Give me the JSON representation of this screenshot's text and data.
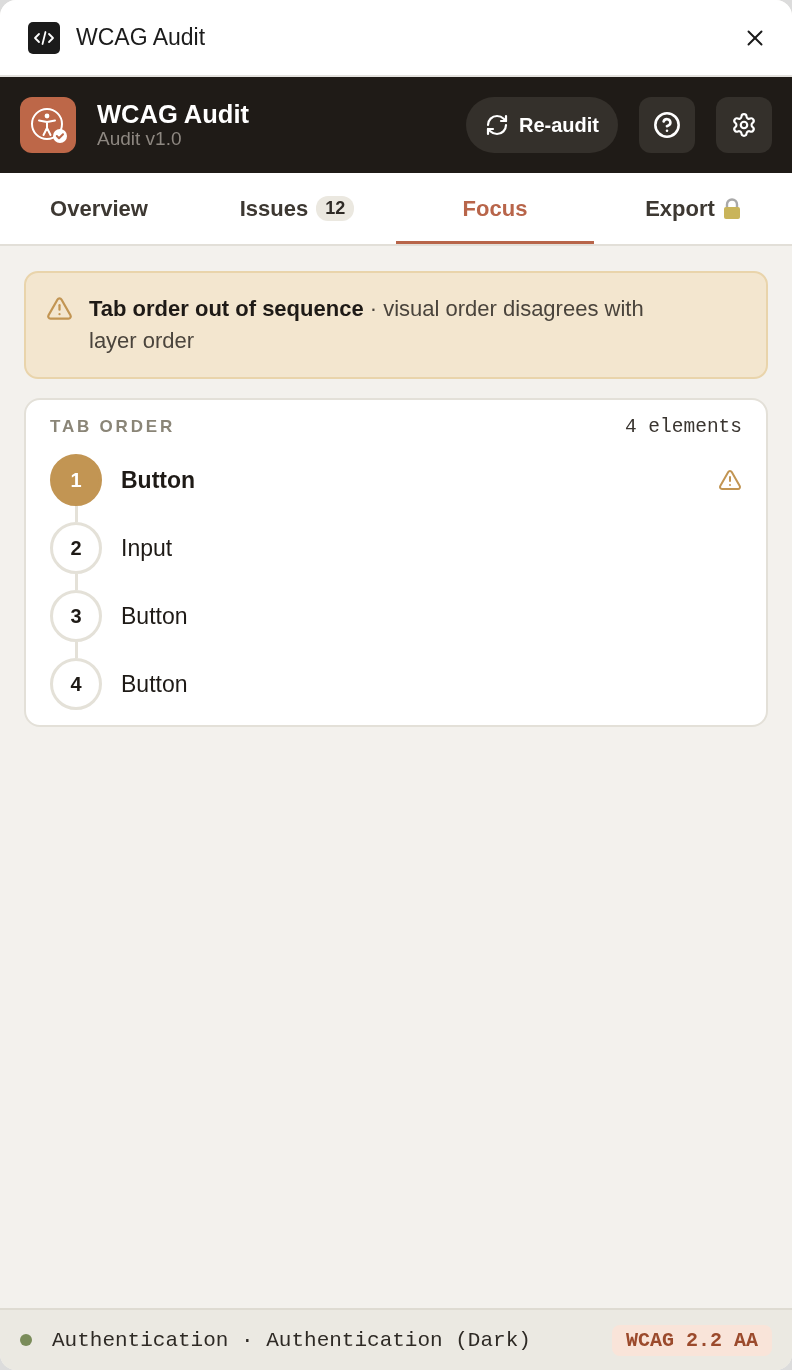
{
  "window": {
    "title": "WCAG Audit"
  },
  "header": {
    "title": "WCAG Audit",
    "subtitle": "Audit v1.0",
    "reaudit_button": "Re-audit"
  },
  "tabs": [
    {
      "label": "Overview",
      "selected": false
    },
    {
      "label": "Issues",
      "badge": "12",
      "selected": false
    },
    {
      "label": "Focus",
      "selected": true
    },
    {
      "label": "Export",
      "locked": true,
      "selected": false
    }
  ],
  "alert": {
    "text": "**Tab order out of sequence** · visual order disagrees with layer order"
  },
  "tab_order": {
    "heading": "TAB ORDER",
    "count": "4 elements",
    "items": [
      {
        "number": "1",
        "label": "Button",
        "selected": true,
        "warning": true
      },
      {
        "number": "2",
        "label": "Input",
        "selected": false,
        "warning": false
      },
      {
        "number": "3",
        "label": "Button",
        "selected": false,
        "warning": false
      },
      {
        "number": "4",
        "label": "Button",
        "selected": false,
        "warning": false
      }
    ]
  },
  "status_bar": {
    "text": "Authentication · Authentication (Dark)",
    "badge": "WCAG 2.2 AA"
  }
}
